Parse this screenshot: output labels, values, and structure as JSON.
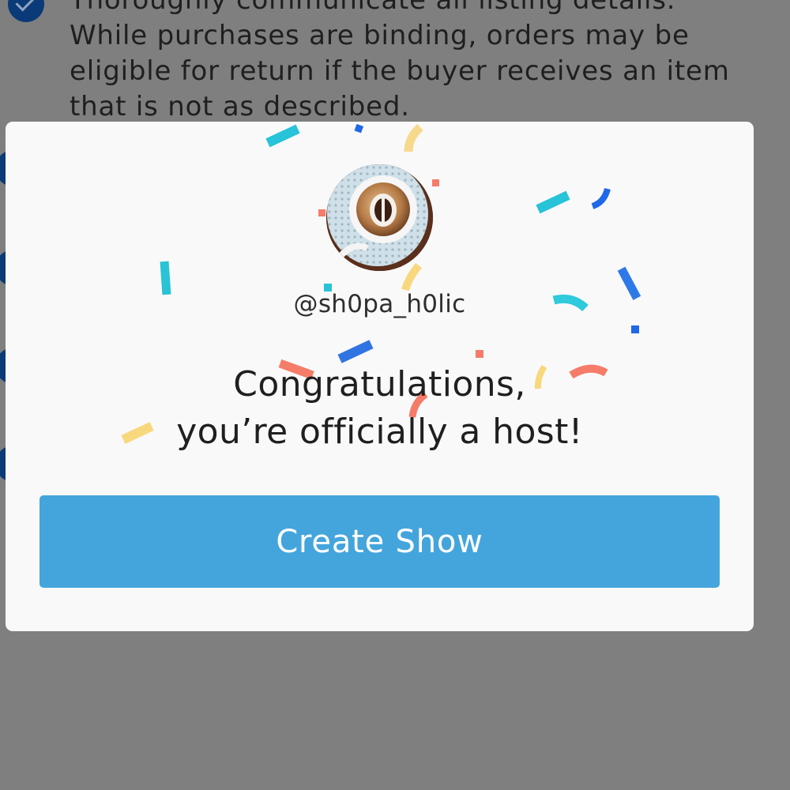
{
  "background_page": {
    "guideline_text": "Thoroughly communicate all listing details. While purchases are binding, orders may be eligible for return if the buyer receives an item that is not as described."
  },
  "modal": {
    "username": "@sh0pa_h0lic",
    "title_line1": "Congratulations,",
    "title_line2": "you’re officially a host!",
    "create_show_label": "Create Show"
  },
  "colors": {
    "modal_background": "#f9f9fa",
    "button_blue": "#44a5dc",
    "overlay_gray": "#7f7f7f"
  },
  "icons": {
    "check": "checkmark-circle-icon",
    "avatar": "coffee-cup-profile-image"
  }
}
